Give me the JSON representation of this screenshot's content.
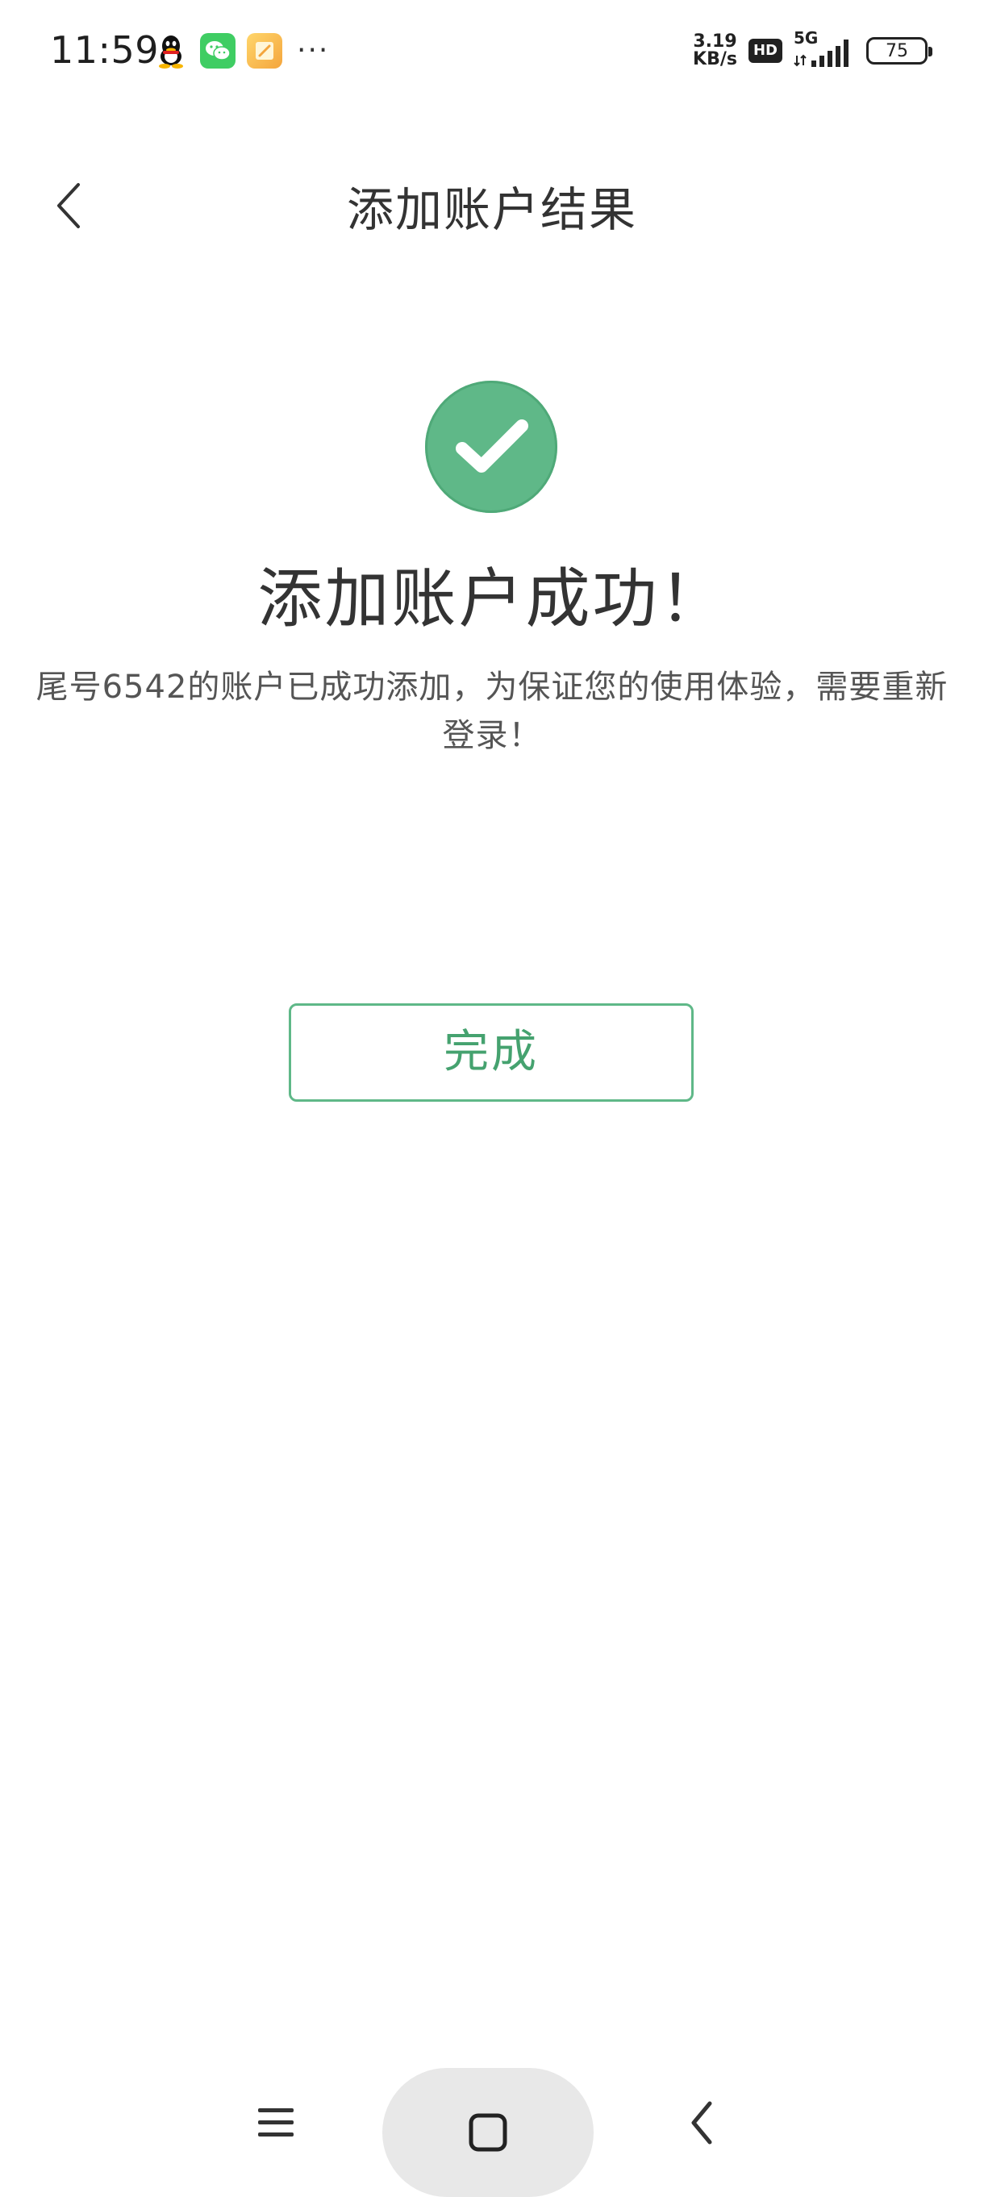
{
  "status_bar": {
    "time": "11:59",
    "notification_icons": [
      "qq-icon",
      "wechat-icon",
      "notes-icon"
    ],
    "more_dots": "···",
    "network_speed_value": "3.19",
    "network_speed_unit": "KB/s",
    "hd_label": "HD",
    "network_type": "5G",
    "battery_level": "75"
  },
  "header": {
    "title": "添加账户结果",
    "back_icon": "chevron-left-icon"
  },
  "result": {
    "icon": "checkmark-icon",
    "icon_color": "#5fb888",
    "title": "添加账户成功！",
    "message": "尾号6542的账户已成功添加，为保证您的使用体验，需要重新登录！"
  },
  "actions": {
    "done_label": "完成",
    "accent_color": "#45a26f"
  },
  "nav_bar": {
    "menu_icon": "menu-icon",
    "home_icon": "home-square-icon",
    "back_icon": "back-chevron-icon"
  }
}
